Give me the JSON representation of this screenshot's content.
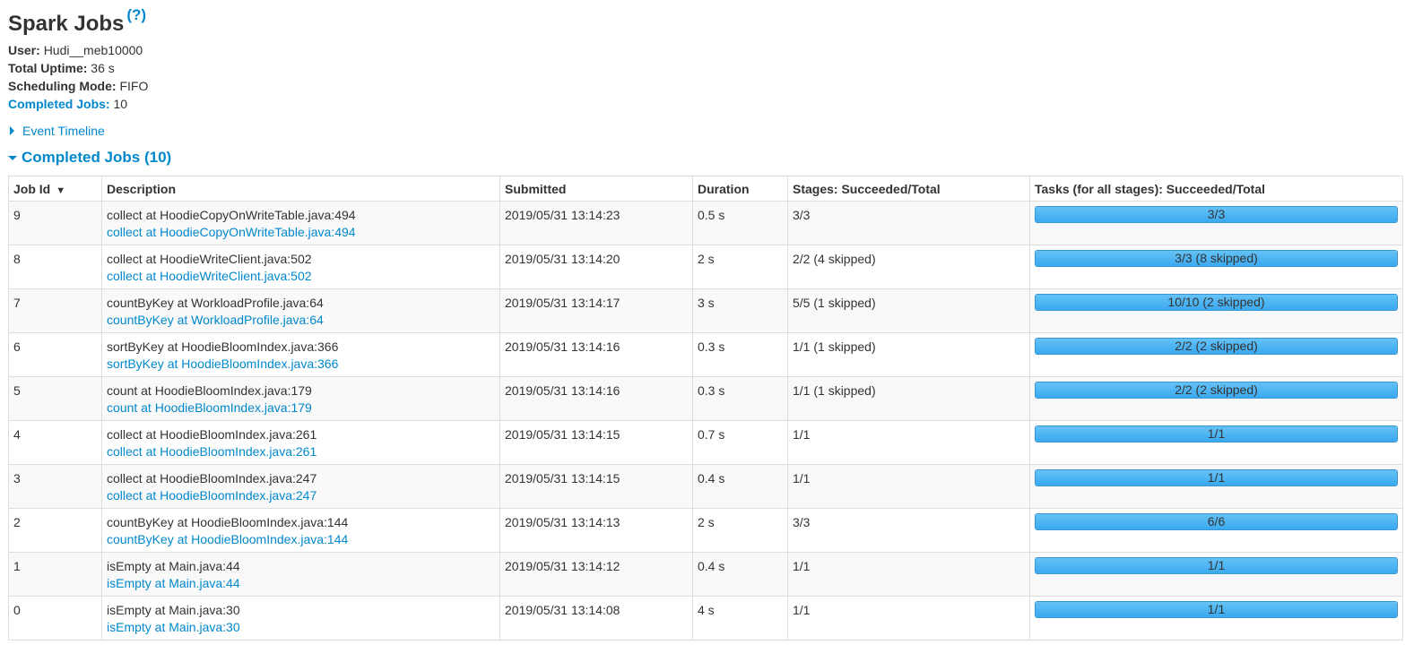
{
  "header": {
    "title": "Spark Jobs",
    "help": "(?)"
  },
  "summary": {
    "user_label": "User:",
    "user_value": "Hudi__meb10000",
    "uptime_label": "Total Uptime:",
    "uptime_value": "36 s",
    "scheduling_label": "Scheduling Mode:",
    "scheduling_value": "FIFO",
    "completed_label": "Completed Jobs:",
    "completed_value": "10"
  },
  "timeline": {
    "label": "Event Timeline"
  },
  "section": {
    "label": "Completed Jobs (10)"
  },
  "table": {
    "headers": {
      "job_id": "Job Id",
      "job_id_sort": "▼",
      "description": "Description",
      "submitted": "Submitted",
      "duration": "Duration",
      "stages": "Stages: Succeeded/Total",
      "tasks": "Tasks (for all stages): Succeeded/Total"
    },
    "rows": [
      {
        "id": "9",
        "desc": "collect at HoodieCopyOnWriteTable.java:494",
        "link": "collect at HoodieCopyOnWriteTable.java:494",
        "submitted": "2019/05/31 13:14:23",
        "duration": "0.5 s",
        "stages": "3/3",
        "tasks": "3/3",
        "progress": 1.0
      },
      {
        "id": "8",
        "desc": "collect at HoodieWriteClient.java:502",
        "link": "collect at HoodieWriteClient.java:502",
        "submitted": "2019/05/31 13:14:20",
        "duration": "2 s",
        "stages": "2/2 (4 skipped)",
        "tasks": "3/3 (8 skipped)",
        "progress": 1.0
      },
      {
        "id": "7",
        "desc": "countByKey at WorkloadProfile.java:64",
        "link": "countByKey at WorkloadProfile.java:64",
        "submitted": "2019/05/31 13:14:17",
        "duration": "3 s",
        "stages": "5/5 (1 skipped)",
        "tasks": "10/10 (2 skipped)",
        "progress": 1.0
      },
      {
        "id": "6",
        "desc": "sortByKey at HoodieBloomIndex.java:366",
        "link": "sortByKey at HoodieBloomIndex.java:366",
        "submitted": "2019/05/31 13:14:16",
        "duration": "0.3 s",
        "stages": "1/1 (1 skipped)",
        "tasks": "2/2 (2 skipped)",
        "progress": 1.0
      },
      {
        "id": "5",
        "desc": "count at HoodieBloomIndex.java:179",
        "link": "count at HoodieBloomIndex.java:179",
        "submitted": "2019/05/31 13:14:16",
        "duration": "0.3 s",
        "stages": "1/1 (1 skipped)",
        "tasks": "2/2 (2 skipped)",
        "progress": 1.0
      },
      {
        "id": "4",
        "desc": "collect at HoodieBloomIndex.java:261",
        "link": "collect at HoodieBloomIndex.java:261",
        "submitted": "2019/05/31 13:14:15",
        "duration": "0.7 s",
        "stages": "1/1",
        "tasks": "1/1",
        "progress": 1.0
      },
      {
        "id": "3",
        "desc": "collect at HoodieBloomIndex.java:247",
        "link": "collect at HoodieBloomIndex.java:247",
        "submitted": "2019/05/31 13:14:15",
        "duration": "0.4 s",
        "stages": "1/1",
        "tasks": "1/1",
        "progress": 1.0
      },
      {
        "id": "2",
        "desc": "countByKey at HoodieBloomIndex.java:144",
        "link": "countByKey at HoodieBloomIndex.java:144",
        "submitted": "2019/05/31 13:14:13",
        "duration": "2 s",
        "stages": "3/3",
        "tasks": "6/6",
        "progress": 1.0
      },
      {
        "id": "1",
        "desc": "isEmpty at Main.java:44",
        "link": "isEmpty at Main.java:44",
        "submitted": "2019/05/31 13:14:12",
        "duration": "0.4 s",
        "stages": "1/1",
        "tasks": "1/1",
        "progress": 1.0
      },
      {
        "id": "0",
        "desc": "isEmpty at Main.java:30",
        "link": "isEmpty at Main.java:30",
        "submitted": "2019/05/31 13:14:08",
        "duration": "4 s",
        "stages": "1/1",
        "tasks": "1/1",
        "progress": 1.0
      }
    ]
  },
  "colors": {
    "link": "#0088cc",
    "progress_fill": "#4db3f2",
    "progress_border": "#3a95d4",
    "row_stripe": "#f9f9f9"
  },
  "icons": {
    "timeline_toggle": "triangle-right-icon",
    "section_toggle": "triangle-down-icon",
    "sort": "sort-desc-icon"
  }
}
